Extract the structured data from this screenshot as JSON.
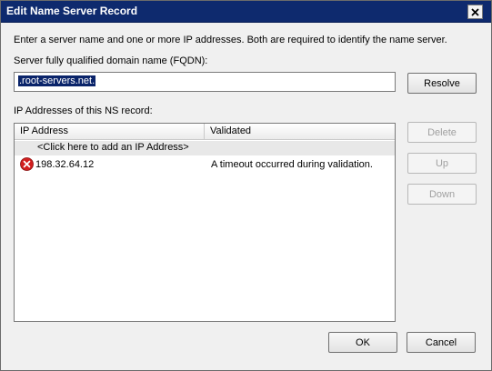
{
  "window": {
    "title": "Edit Name Server Record"
  },
  "instructions": "Enter a server name and one or more IP addresses.  Both are required to identify the name server.",
  "fqdn": {
    "label": "Server fully qualified domain name (FQDN):",
    "value": ".root-servers.net."
  },
  "buttons": {
    "resolve": "Resolve",
    "delete": "Delete",
    "up": "Up",
    "down": "Down",
    "ok": "OK",
    "cancel": "Cancel"
  },
  "ip_list": {
    "label": "IP Addresses of this NS record:",
    "columns": [
      "IP Address",
      "Validated"
    ],
    "add_row_text": "<Click here to add an IP Address>",
    "rows": [
      {
        "ip": "198.32.64.12",
        "status": "A timeout occurred during validation.",
        "status_icon": "error-icon"
      }
    ]
  },
  "colors": {
    "titlebar": "#0e2a6e",
    "selection": "#0a246a",
    "error": "#d21f1f"
  }
}
